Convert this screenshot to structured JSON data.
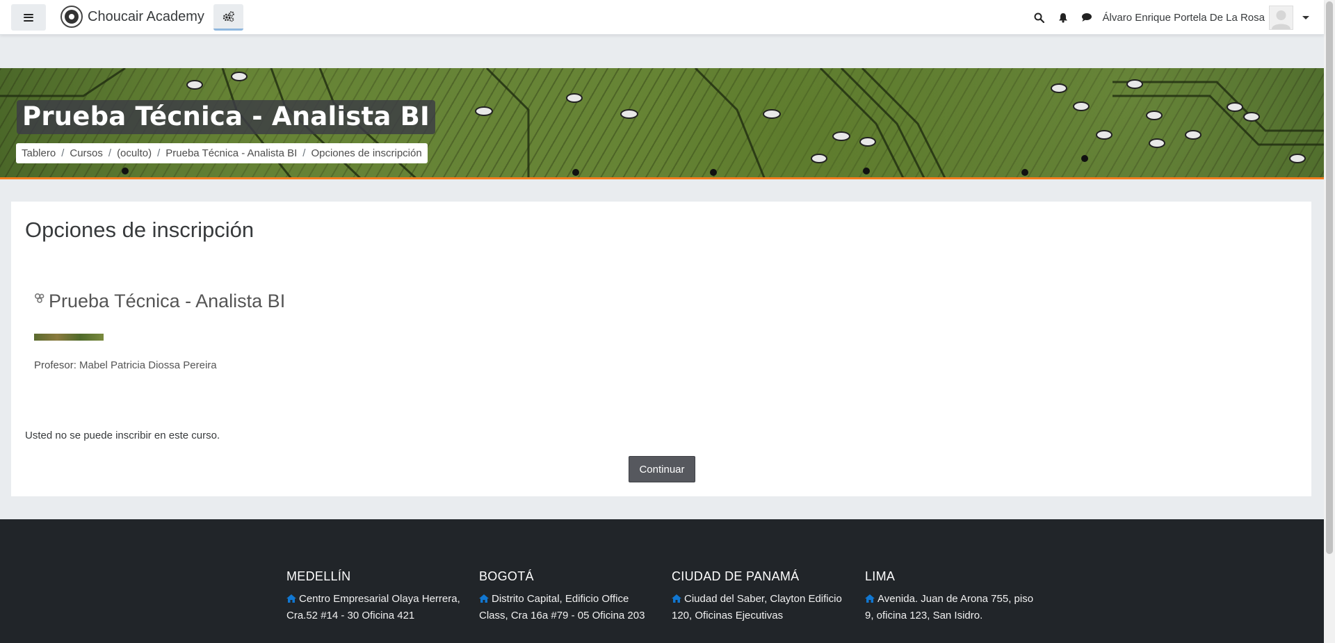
{
  "navbar": {
    "brand_name": "Choucair Academy",
    "user_name": "Álvaro Enrique Portela De La Rosa"
  },
  "header": {
    "page_title": "Prueba Técnica - Analista BI",
    "breadcrumb": [
      "Tablero",
      "Cursos",
      "(oculto)",
      "Prueba Técnica - Analista BI",
      "Opciones de inscripción"
    ]
  },
  "main": {
    "title": "Opciones de inscripción",
    "course_name": "Prueba Técnica - Analista BI",
    "teacher_label": "Profesor:",
    "teacher_name": "Mabel Patricia Diossa Pereira",
    "enrol_message": "Usted no se puede inscribir en este curso.",
    "continue_label": "Continuar"
  },
  "footer": {
    "offices": [
      {
        "city": "MEDELLÍN",
        "address": "Centro Empresarial Olaya Herrera, Cra.52 #14 - 30 Oficina 421"
      },
      {
        "city": "BOGOTÁ",
        "address": "Distrito Capital, Edificio Office Class, Cra 16a #79 - 05 Oficina 203"
      },
      {
        "city": "CIUDAD DE PANAMÁ",
        "address": "Ciudad del Saber, Clayton Edificio 120, Oficinas Ejecutivas"
      },
      {
        "city": "LIMA",
        "address": "Avenida. Juan de Arona 755, piso 9, oficina 123, San Isidro."
      }
    ]
  },
  "colors": {
    "accent": "#f27c1d",
    "footer_bg": "#212529",
    "button_bg": "#56585e",
    "icon_blue": "#1177d1"
  }
}
